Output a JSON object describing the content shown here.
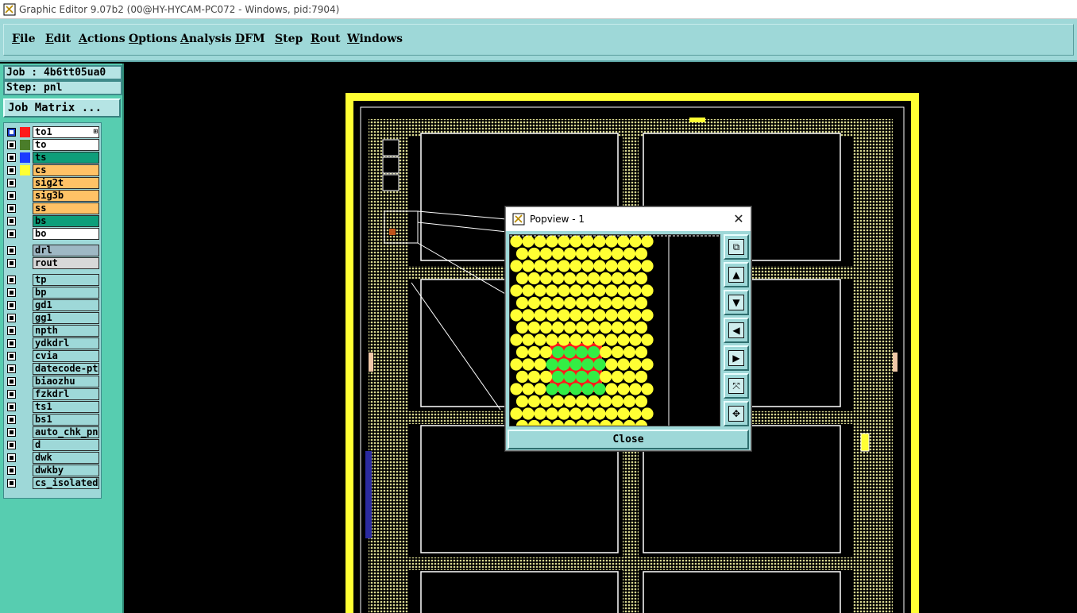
{
  "window": {
    "title": "Graphic Editor 9.07b2 (00@HY-HYCAM-PC072 - Windows, pid:7904)"
  },
  "menu": [
    {
      "label": "File"
    },
    {
      "label": "Edit"
    },
    {
      "label": "Actions"
    },
    {
      "label": "Options"
    },
    {
      "label": "Analysis"
    },
    {
      "label": "DFM"
    },
    {
      "label": "Step"
    },
    {
      "label": "Rout"
    },
    {
      "label": "Windows"
    }
  ],
  "sidebar": {
    "job": "Job : 4b6tt05ua0",
    "step": "Step: pnl",
    "job_matrix": "Job Matrix ...",
    "layers": [
      {
        "name": "to1",
        "color": "#ff1a1a",
        "bg": "#ffffff",
        "selected": true
      },
      {
        "name": "to",
        "color": "#4a7d2a",
        "bg": "#ffffff"
      },
      {
        "name": "ts",
        "color": "#1a3cff",
        "bg": "#0e9e7a"
      },
      {
        "name": "cs",
        "color": "#ffff33",
        "bg": "#ffc266"
      },
      {
        "name": "sig2t",
        "color": "",
        "bg": "#ffc266"
      },
      {
        "name": "sig3b",
        "color": "",
        "bg": "#ffc266"
      },
      {
        "name": "ss",
        "color": "",
        "bg": "#ffc266"
      },
      {
        "name": "bs",
        "color": "",
        "bg": "#0e9e7a"
      },
      {
        "name": "bo",
        "color": "",
        "bg": "#ffffff"
      },
      {
        "name": "drl",
        "color": "",
        "bg": "#9eb8c4"
      },
      {
        "name": "rout",
        "color": "",
        "bg": "#d8d8d8"
      },
      {
        "name": "tp",
        "color": "",
        "bg": "#9ed8d8"
      },
      {
        "name": "bp",
        "color": "",
        "bg": "#9ed8d8"
      },
      {
        "name": "gd1",
        "color": "",
        "bg": "#9ed8d8"
      },
      {
        "name": "gg1",
        "color": "",
        "bg": "#9ed8d8"
      },
      {
        "name": "npth",
        "color": "",
        "bg": "#9ed8d8"
      },
      {
        "name": "ydkdrl",
        "color": "",
        "bg": "#9ed8d8"
      },
      {
        "name": "cvia",
        "color": "",
        "bg": "#9ed8d8"
      },
      {
        "name": "datecode-pto",
        "color": "",
        "bg": "#9ed8d8"
      },
      {
        "name": "biaozhu",
        "color": "",
        "bg": "#9ed8d8"
      },
      {
        "name": "fzkdrl",
        "color": "",
        "bg": "#9ed8d8"
      },
      {
        "name": "ts1",
        "color": "",
        "bg": "#9ed8d8"
      },
      {
        "name": "bs1",
        "color": "",
        "bg": "#9ed8d8"
      },
      {
        "name": "auto_chk_pnl",
        "color": "",
        "bg": "#9ed8d8"
      },
      {
        "name": "d",
        "color": "",
        "bg": "#9ed8d8"
      },
      {
        "name": "dwk",
        "color": "",
        "bg": "#9ed8d8"
      },
      {
        "name": "dwkby",
        "color": "",
        "bg": "#9ed8d8"
      },
      {
        "name": "cs_isolated",
        "color": "",
        "bg": "#9ed8d8"
      }
    ]
  },
  "popview": {
    "title": "Popview - 1",
    "close_label": "Close",
    "tools": [
      {
        "icon": "zoom-fit-icon",
        "glyph": "⧉"
      },
      {
        "icon": "pan-up-icon",
        "glyph": "▲"
      },
      {
        "icon": "pan-down-icon",
        "glyph": "▼"
      },
      {
        "icon": "pan-left-icon",
        "glyph": "◀"
      },
      {
        "icon": "pan-right-icon",
        "glyph": "▶"
      },
      {
        "icon": "zoom-in-icon",
        "glyph": "⤧"
      },
      {
        "icon": "zoom-out-icon",
        "glyph": "✥"
      }
    ]
  },
  "colors": {
    "board_outline": "#ffff33",
    "copper_fill": "#d8d890",
    "trace": "#ffffff",
    "highlight_red": "#ff1a1a",
    "highlight_green": "#33ee44"
  }
}
